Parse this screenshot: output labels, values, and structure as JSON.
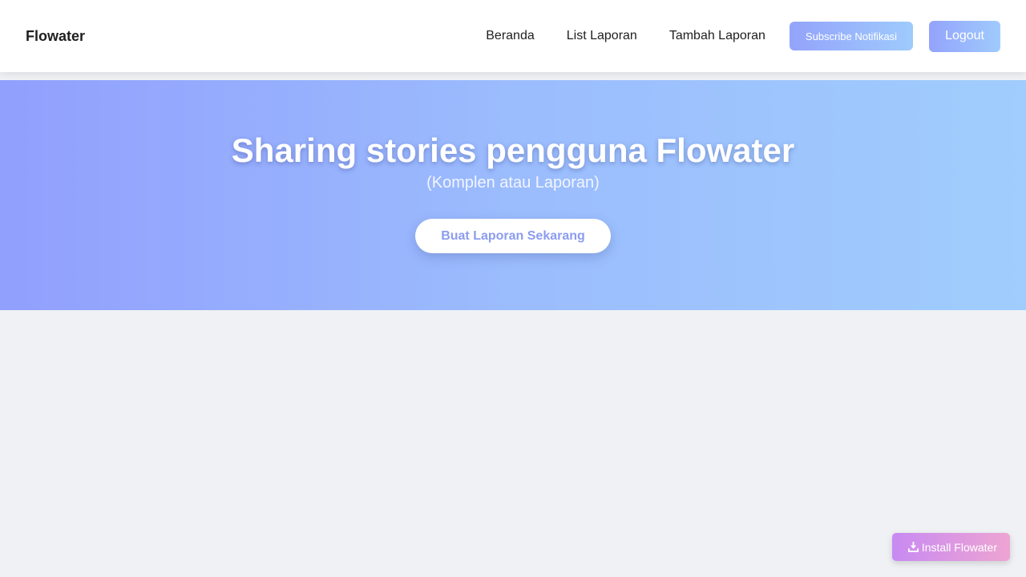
{
  "navbar": {
    "brand": "Flowater",
    "links": [
      {
        "label": "Beranda"
      },
      {
        "label": "List Laporan"
      },
      {
        "label": "Tambah Laporan"
      }
    ],
    "subscribe_label": "Subscribe Notifikasi",
    "logout_label": "Logout"
  },
  "hero": {
    "title": "Sharing stories pengguna Flowater",
    "subtitle": "(Komplen atau Laporan)",
    "cta_label": "Buat Laporan Sekarang"
  },
  "install": {
    "label": "Install Flowater",
    "icon": "download-icon"
  },
  "colors": {
    "page_background": "#eff1f4",
    "hero_gradient_start": "#919ffd",
    "hero_gradient_end": "#a0cdfd",
    "cta_text": "#8c9cf0",
    "install_gradient_start": "#c88af2",
    "install_gradient_end": "#eea4d2"
  }
}
